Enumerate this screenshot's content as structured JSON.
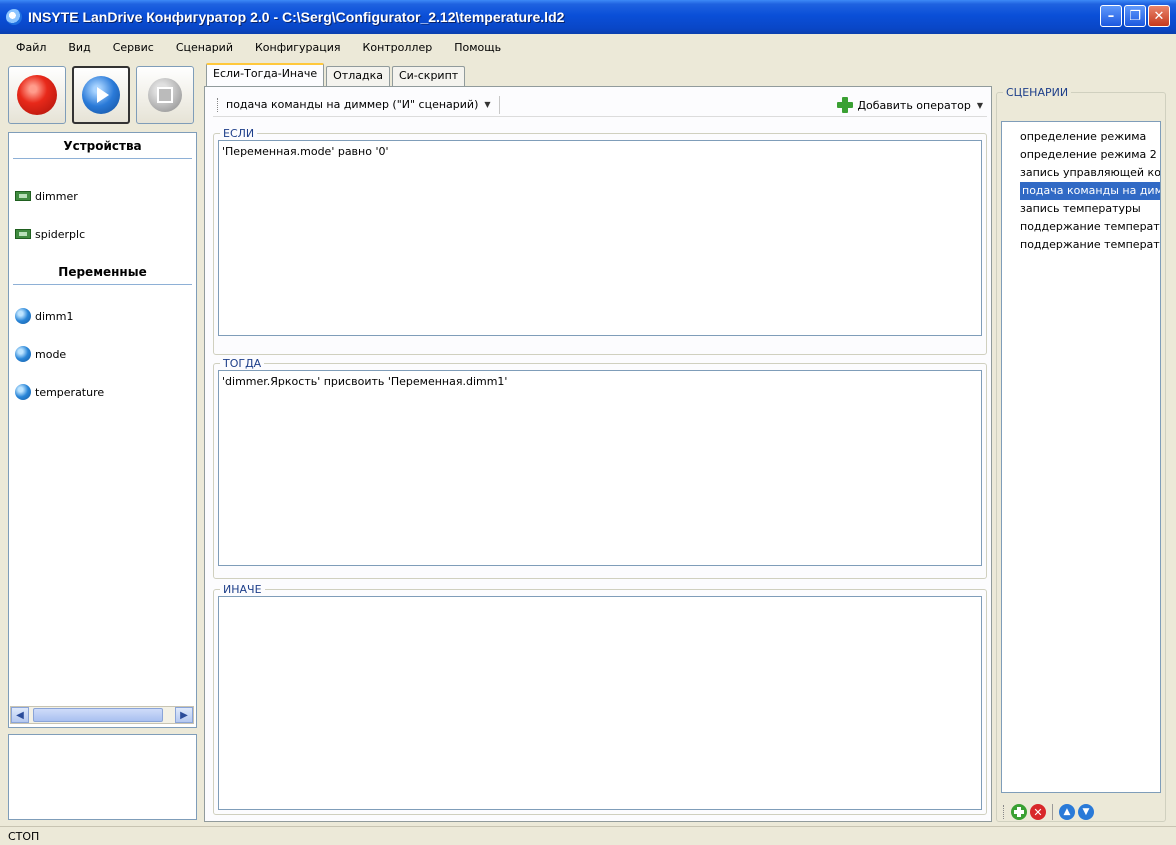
{
  "window": {
    "title": "INSYTE LanDrive Конфигуратор 2.0 - C:\\Serg\\Configurator_2.12\\temperature.ld2",
    "minimize": "–",
    "restore": "❐",
    "close": "✕"
  },
  "menu": [
    "Файл",
    "Вид",
    "Сервис",
    "Сценарий",
    "Конфигурация",
    "Контроллер",
    "Помощь"
  ],
  "left": {
    "devices_header": "Устройства",
    "devices": [
      "dimmer",
      "spiderplc"
    ],
    "variables_header": "Переменные",
    "variables": [
      "dimm1",
      "mode",
      "temperature"
    ]
  },
  "tabs": [
    "Если-Тогда-Иначе",
    "Отладка",
    "Си-скрипт"
  ],
  "center": {
    "scenario_dropdown": "подача команды на диммер  (\"И\" сценарий)",
    "add_operator": "Добавить оператор",
    "if_label": "ЕСЛИ",
    "if_text": "'Переменная.mode' равно '0'",
    "then_label": "ТОГДА",
    "then_text": "'dimmer.Яркость' присвоить 'Переменная.dimm1'",
    "else_label": "ИНАЧЕ",
    "else_text": ""
  },
  "scenarios": {
    "label": "СЦЕНАРИИ",
    "items": [
      "определение режима",
      "определение режима 2",
      "запись управляющей ко",
      "подача команды на дим",
      "запись температуры",
      "поддержание температу",
      "поддержание температу"
    ],
    "selected_index": 3
  },
  "status": "СТОП"
}
